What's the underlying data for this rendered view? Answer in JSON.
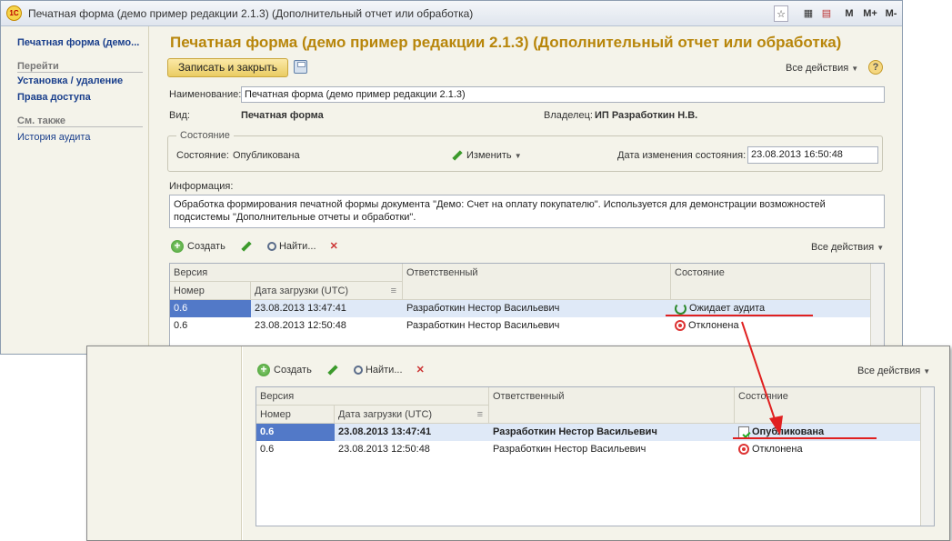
{
  "window": {
    "title": "Печатная форма (демо пример редакции 2.1.3) (Дополнительный отчет или обработка)",
    "logo_text": "1С",
    "title_buttons": [
      "M",
      "M+",
      "M-"
    ]
  },
  "sidebar": {
    "current": "Печатная форма (демо...",
    "goto_header": "Перейти",
    "goto_items": [
      "Установка / удаление",
      "Права доступа"
    ],
    "see_also_header": "См. также",
    "see_also_items": [
      "История аудита"
    ]
  },
  "form": {
    "heading": "Печатная форма (демо пример редакции 2.1.3) (Дополнительный отчет или обработка)",
    "save_close": "Записать и закрыть",
    "all_actions": "Все действия",
    "name_label": "Наименование:",
    "name_value": "Печатная форма (демо пример редакции 2.1.3)",
    "kind_label": "Вид:",
    "kind_value": "Печатная форма",
    "owner_label": "Владелец:",
    "owner_value": "ИП Разработкин Н.В.",
    "state_group": "Состояние",
    "state_label": "Состояние:",
    "state_value": "Опубликована",
    "change_label": "Изменить",
    "state_date_label": "Дата изменения состояния:",
    "state_date_value": "23.08.2013 16:50:48",
    "info_label": "Информация:",
    "info_text": "Обработка формирования печатной формы документа \"Демо: Счет на оплату покупателю\". Используется для демонстрации возможностей подсистемы \"Дополнительные отчеты и обработки\"."
  },
  "toolbar": {
    "create": "Создать",
    "find": "Найти...",
    "all_actions": "Все действия"
  },
  "versions_table": {
    "group_header": "Версия",
    "columns": [
      "Номер",
      "Дата загрузки (UTC)",
      "Ответственный",
      "Состояние"
    ],
    "rows": [
      {
        "number": "0.6",
        "date": "23.08.2013 13:47:41",
        "responsible": "Разработкин Нестор Васильевич",
        "state": "Ожидает аудита",
        "state_icon": "refresh-icon"
      },
      {
        "number": "0.6",
        "date": "23.08.2013 12:50:48",
        "responsible": "Разработкин Нестор Васильевич",
        "state": "Отклонена",
        "state_icon": "stop-icon"
      }
    ]
  },
  "zoom_table": {
    "rows": [
      {
        "number": "0.6",
        "date": "23.08.2013 13:47:41",
        "responsible": "Разработкин Нестор Васильевич",
        "state": "Опубликована",
        "state_icon": "published-icon"
      },
      {
        "number": "0.6",
        "date": "23.08.2013 12:50:48",
        "responsible": "Разработкин Нестор Васильевич",
        "state": "Отклонена",
        "state_icon": "stop-icon"
      }
    ]
  },
  "colors": {
    "accent_title": "#b8860b",
    "selection": "#5279c8",
    "annotation": "#e02020"
  }
}
